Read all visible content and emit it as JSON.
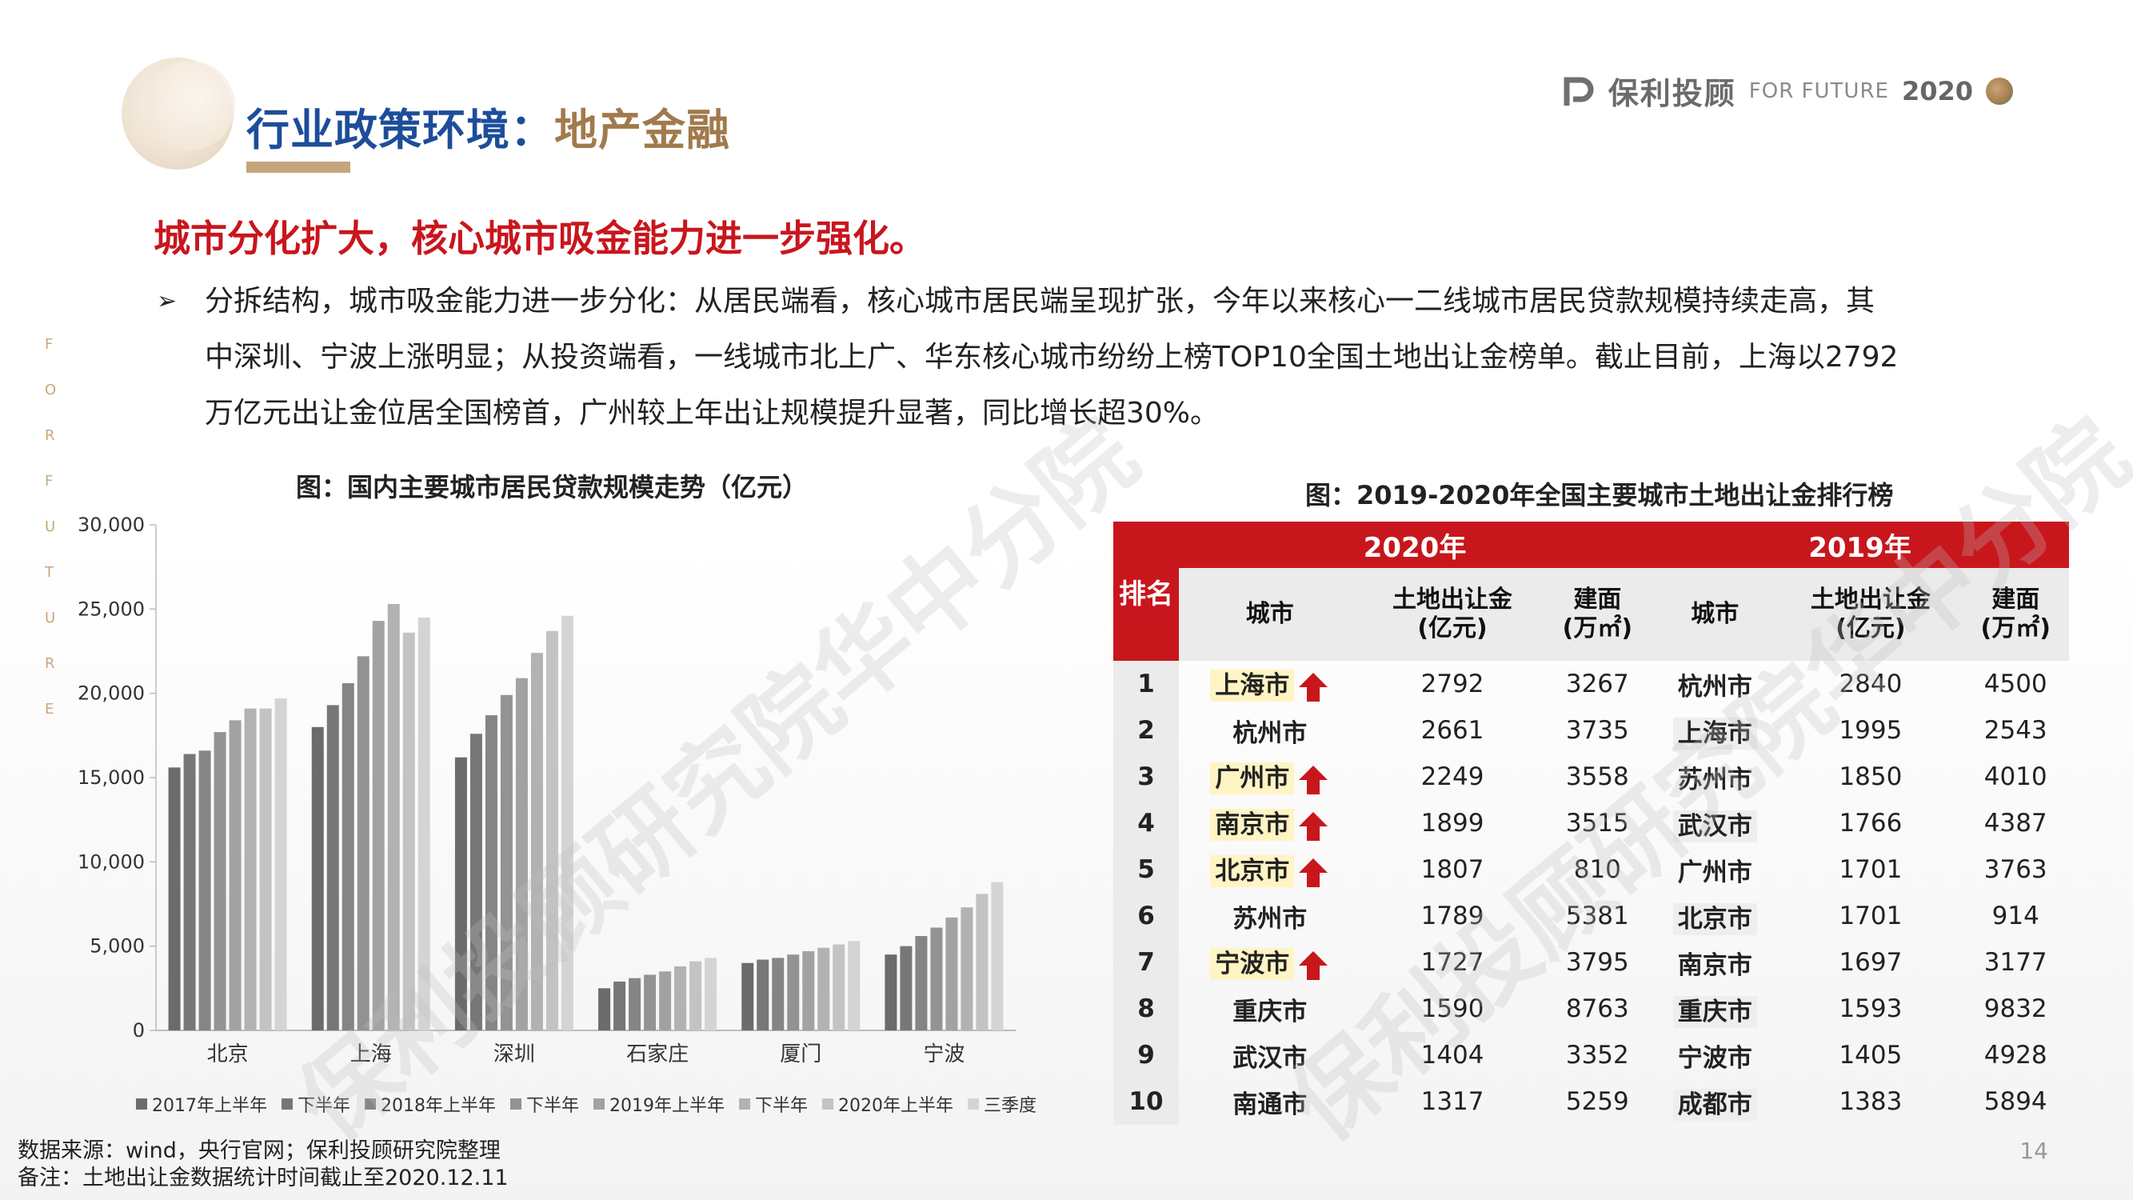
{
  "header": {
    "title_part1": "行业政策环境：",
    "title_part2": "地产金融",
    "logo_brand": "保利",
    "logo_brand2": "投顾",
    "logo_tag": "FOR FUTURE",
    "logo_year": "2020"
  },
  "side_letters": [
    "F",
    "O",
    "R",
    "F",
    "U",
    "T",
    "U",
    "R",
    "E"
  ],
  "headline": "城市分化扩大，核心城市吸金能力进一步强化。",
  "bullet": {
    "line1": "分拆结构，城市吸金能力进一步分化：从居民端看，核心城市居民端呈现扩张，今年以来核心一二线城市居民贷款规模持续走高，其",
    "line2": "中深圳、宁波上涨明显；从投资端看，一线城市北上广、华东核心城市纷纷上榜TOP10全国土地出让金榜单。截止目前，上海以2792",
    "line3": "万亿元出让金位居全国榜首，广州较上年出让规模提升显著，同比增长超30%。"
  },
  "chart_title": "图：国内主要城市居民贷款规模走势（亿元）",
  "table_title": "图：2019-2020年全国主要城市土地出让金排行榜",
  "chart_data": {
    "type": "bar",
    "categories": [
      "北京",
      "上海",
      "深圳",
      "石家庄",
      "厦门",
      "宁波"
    ],
    "ylim": [
      0,
      30000
    ],
    "yticks": [
      "0",
      "5,000",
      "10,000",
      "15,000",
      "20,000",
      "25,000",
      "30,000"
    ],
    "ytick_values": [
      0,
      5000,
      10000,
      15000,
      20000,
      25000,
      30000
    ],
    "series": [
      {
        "name": "2017年上半年",
        "color": "#6b6b6b",
        "values": [
          15600,
          18000,
          16200,
          2500,
          4000,
          4500
        ]
      },
      {
        "name": "下半年",
        "color": "#777777",
        "values": [
          16400,
          19300,
          17600,
          2900,
          4200,
          5000
        ]
      },
      {
        "name": "2018年上半年",
        "color": "#858585",
        "values": [
          16600,
          20600,
          18700,
          3100,
          4300,
          5600
        ]
      },
      {
        "name": "下半年",
        "color": "#939393",
        "values": [
          17700,
          22200,
          19900,
          3300,
          4500,
          6100
        ]
      },
      {
        "name": "2019年上半年",
        "color": "#a2a2a2",
        "values": [
          18400,
          24300,
          20900,
          3500,
          4700,
          6700
        ]
      },
      {
        "name": "下半年",
        "color": "#b2b2b2",
        "values": [
          19100,
          25300,
          22400,
          3800,
          4900,
          7300
        ]
      },
      {
        "name": "2020年上半年",
        "color": "#c3c3c3",
        "values": [
          19100,
          23600,
          23700,
          4100,
          5100,
          8100
        ]
      },
      {
        "name": "三季度",
        "color": "#d4d4d4",
        "values": [
          19700,
          24500,
          24600,
          4300,
          5300,
          8800
        ]
      }
    ]
  },
  "table": {
    "year2020": "2020年",
    "year2019": "2019年",
    "rank_header": "排名",
    "col_city": "城市",
    "col_land": "土地出让金",
    "col_land_unit": "(亿元)",
    "col_area": "建面",
    "col_area_unit": "(万㎡)",
    "rows": [
      {
        "rank": "1",
        "city20": "上海市",
        "land20": "2792",
        "area20": "3267",
        "city19": "杭州市",
        "land19": "2840",
        "area19": "4500",
        "up": true
      },
      {
        "rank": "2",
        "city20": "杭州市",
        "land20": "2661",
        "area20": "3735",
        "city19": "上海市",
        "land19": "1995",
        "area19": "2543",
        "up": false
      },
      {
        "rank": "3",
        "city20": "广州市",
        "land20": "2249",
        "area20": "3558",
        "city19": "苏州市",
        "land19": "1850",
        "area19": "4010",
        "up": true
      },
      {
        "rank": "4",
        "city20": "南京市",
        "land20": "1899",
        "area20": "3515",
        "city19": "武汉市",
        "land19": "1766",
        "area19": "4387",
        "up": true
      },
      {
        "rank": "5",
        "city20": "北京市",
        "land20": "1807",
        "area20": "810",
        "city19": "广州市",
        "land19": "1701",
        "area19": "3763",
        "up": true
      },
      {
        "rank": "6",
        "city20": "苏州市",
        "land20": "1789",
        "area20": "5381",
        "city19": "北京市",
        "land19": "1701",
        "area19": "914",
        "up": false
      },
      {
        "rank": "7",
        "city20": "宁波市",
        "land20": "1727",
        "area20": "3795",
        "city19": "南京市",
        "land19": "1697",
        "area19": "3177",
        "up": true
      },
      {
        "rank": "8",
        "city20": "重庆市",
        "land20": "1590",
        "area20": "8763",
        "city19": "重庆市",
        "land19": "1593",
        "area19": "9832",
        "up": false
      },
      {
        "rank": "9",
        "city20": "武汉市",
        "land20": "1404",
        "area20": "3352",
        "city19": "宁波市",
        "land19": "1405",
        "area19": "4928",
        "up": false
      },
      {
        "rank": "10",
        "city20": "南通市",
        "land20": "1317",
        "area20": "5259",
        "city19": "成都市",
        "land19": "1383",
        "area19": "5894",
        "up": false
      }
    ]
  },
  "footer": {
    "source": "数据来源：wind，央行官网；保利投顾研究院整理",
    "note": "备注：土地出让金数据统计时间截止至2020.12.11"
  },
  "page_number": "14",
  "watermark": "保利投顾研究院华中分院"
}
